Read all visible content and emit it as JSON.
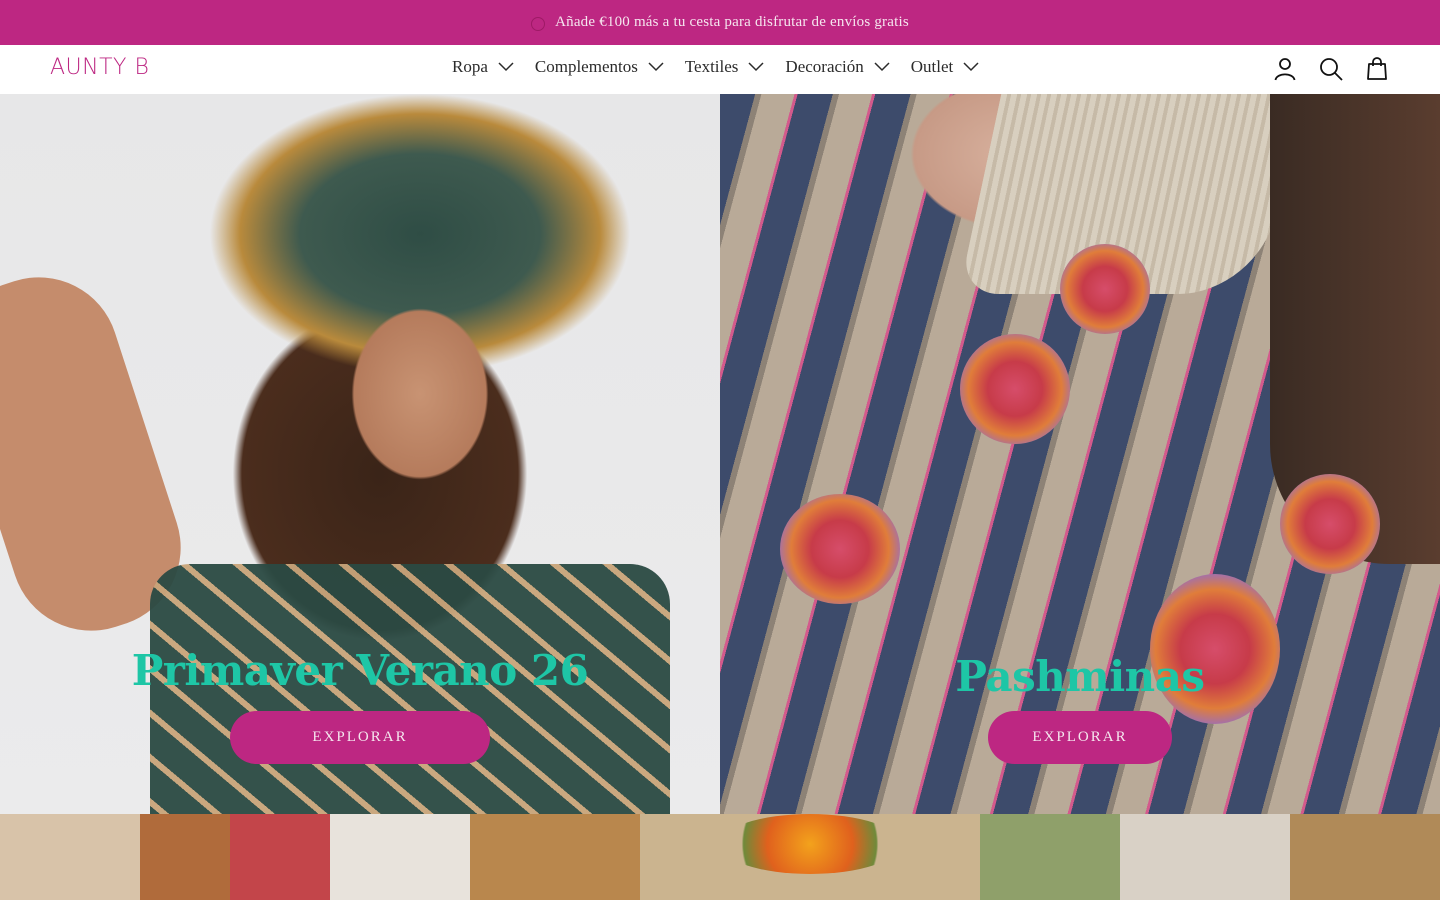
{
  "colors": {
    "brand": "#bd2782",
    "accent_text": "#1ec6a6",
    "button_text": "#f5e6ee"
  },
  "announcement": {
    "text": "Añade €100 más a tu cesta para disfrutar de envíos gratis"
  },
  "header": {
    "logo": "AUNTY B",
    "nav": [
      {
        "label": "Ropa"
      },
      {
        "label": "Complementos"
      },
      {
        "label": "Textiles"
      },
      {
        "label": "Decoración"
      },
      {
        "label": "Outlet"
      }
    ],
    "icons": [
      "account-icon",
      "search-icon",
      "cart-icon"
    ]
  },
  "hero": {
    "left": {
      "title": "Primaver Verano 26",
      "button": "EXPLORAR"
    },
    "right": {
      "title": "Pashminas",
      "button": "EXPLORAR"
    }
  }
}
